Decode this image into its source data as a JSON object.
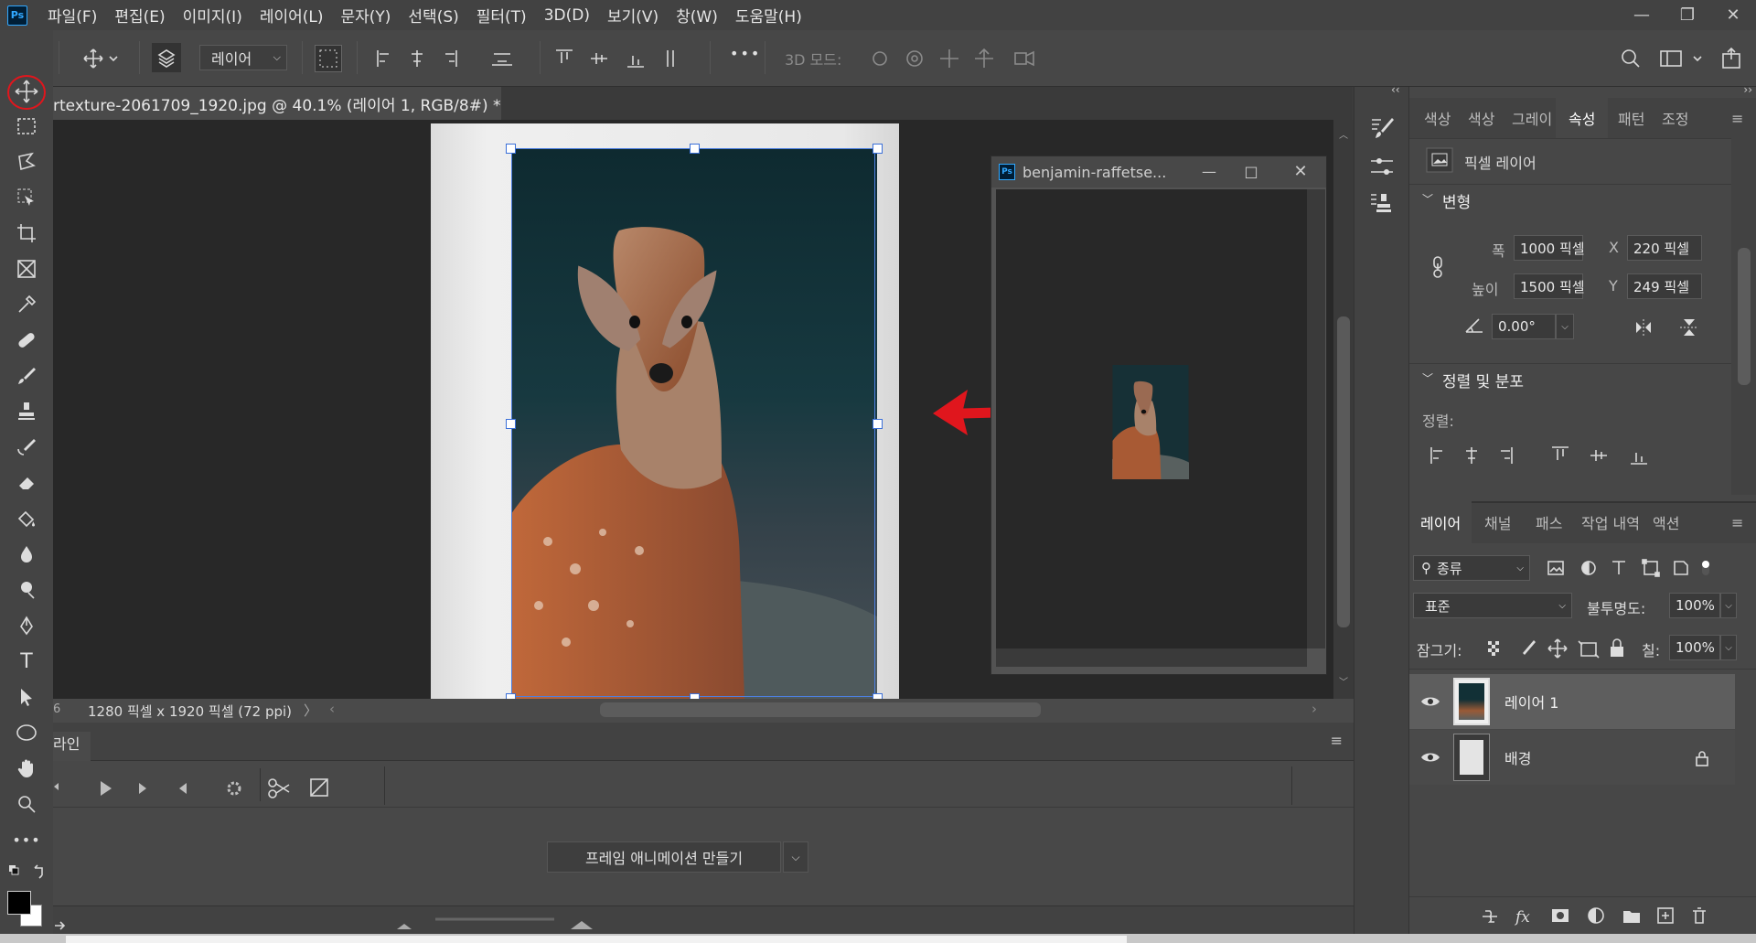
{
  "app": {
    "logo": "Ps",
    "annotation_color": "#e0161d"
  },
  "menu": [
    "파일(F)",
    "편집(E)",
    "이미지(I)",
    "레이어(L)",
    "문자(Y)",
    "선택(S)",
    "필터(T)",
    "3D(D)",
    "보기(V)",
    "창(W)",
    "도움말(H)"
  ],
  "window_controls": {
    "minimize": "—",
    "restore": "❐",
    "close": "✕"
  },
  "options": {
    "layer_select": "레이어",
    "mode_label": "3D 모드:",
    "more": "•••"
  },
  "toolbar_header": {
    "expand": "››",
    "close": "✕"
  },
  "document": {
    "tab_title": "rtexture-2061709_1920.jpg @ 40.1% (레이어 1, RGB/8#) *",
    "tab_close": "×",
    "status": "1280 픽셀 x 1920 픽셀 (72 ppi)",
    "status_left": "6"
  },
  "floating_window": {
    "title": "benjamin-raffetse..."
  },
  "timeline": {
    "title": "라인",
    "create_button": "프레임 애니메이션 만들기"
  },
  "properties": {
    "tabs": [
      "색상",
      "색상",
      "그레이",
      "속성",
      "패턴",
      "조정"
    ],
    "active_tab": "속성",
    "kind": "픽셀 레이어",
    "transform_heading": "변형",
    "width_label": "폭",
    "width_value": "1000 픽셀",
    "height_label": "높이",
    "height_value": "1500 픽셀",
    "x_label": "X",
    "x_value": "220 픽셀",
    "y_label": "Y",
    "y_value": "249 픽셀",
    "angle_value": "0.00°",
    "align_heading": "정렬 및 분포",
    "align_label": "정렬:"
  },
  "layers_panel": {
    "tabs": [
      "레이어",
      "채널",
      "패스",
      "작업 내역",
      "액션"
    ],
    "filter": "종류",
    "blend_mode": "표준",
    "opacity_label": "불투명도:",
    "opacity_value": "100%",
    "lock_label": "잠그기:",
    "fill_label": "칠:",
    "fill_value": "100%",
    "layers": [
      {
        "name": "레이어 1",
        "visible": true,
        "selected": true,
        "locked": false
      },
      {
        "name": "배경",
        "visible": true,
        "selected": false,
        "locked": true
      }
    ]
  }
}
